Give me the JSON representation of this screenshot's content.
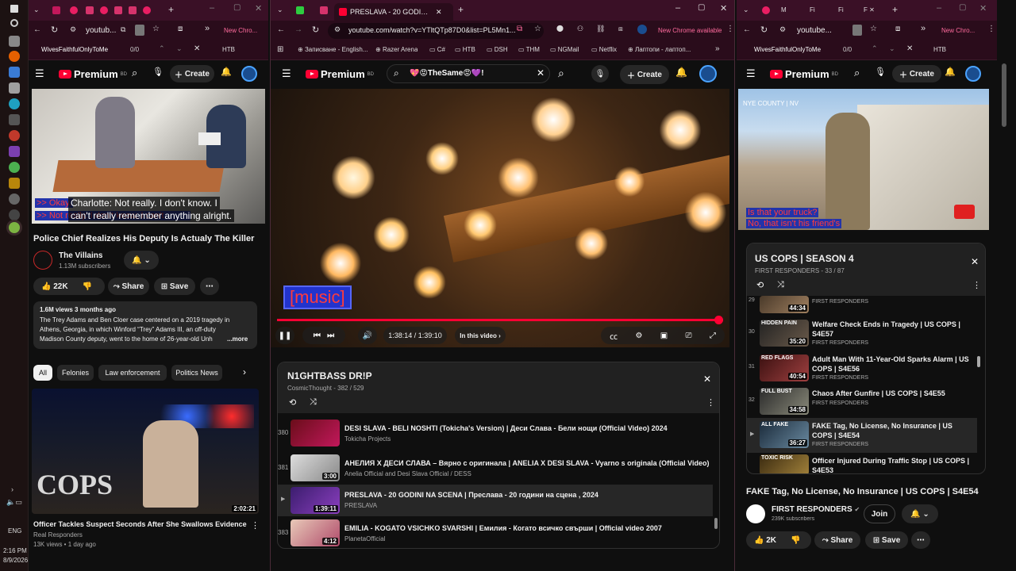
{
  "taskbar": {
    "time": "2:16 PM",
    "date": "8/9/2026",
    "lang": "ENG"
  },
  "left": {
    "tab_text": "youtub...",
    "find_text": "WivesFaithfulOnlyToMe",
    "find_count": "0/0",
    "bookmark": "HTB",
    "yt": {
      "logo": "Premium",
      "badge": "BD",
      "create": "Create"
    },
    "captions": [
      "Charlotte: Not really. I don't know. I",
      "can't really remember anything alright."
    ],
    "caption_overlay": [
      ">> Okay.",
      ">> Not really. I don't know. I can't"
    ],
    "title": "Police Chief Realizes His Deputy Is Actualy The Killer",
    "channel": "The Villains",
    "subs": "1.13M subscribers",
    "likes": "22K",
    "share": "Share",
    "save": "Save",
    "meta": "1.6M views  3 months ago",
    "desc1": "The Trey Adams and Ben Cloer case centered on a 2019 tragedy in",
    "desc2": "Athens, Georgia, in which Winford “Trey” Adams III, an off-duty",
    "desc3": "Madison County deputy, went to the home of 26-year-old Unh",
    "more": "...more",
    "chips": [
      "All",
      "Felonies",
      "Law enforcement",
      "Politics News"
    ],
    "rec_title": "Officer Tackles Suspect Seconds After She Swallows Evidence",
    "rec_channel": "Real Responders",
    "rec_meta": "13K views • 1 day ago",
    "rec_dur": "2:02:21",
    "cops": "COPS"
  },
  "mid": {
    "tab_title": "PRESLAVA - 20 GODINI NA",
    "chrome_avail": "New Chrome available",
    "url": "youtube.com/watch?v=YTltQTp87D0&list=PL5Mn1...",
    "bookmarks": [
      "Записване - English...",
      "Razer Arena",
      "C#",
      "HTB",
      "DSH",
      "THM",
      "NGMail",
      "Netflix",
      "Лаптопи - лаптоп..."
    ],
    "yt": {
      "logo": "Premium",
      "badge": "BD",
      "create": "Create",
      "search": "💖😡TheSame😡💜!"
    },
    "caption": "[music]",
    "time": "1:38:14 / 1:39:10",
    "in_video": "In this video",
    "progress": 0.99,
    "playlist": {
      "title": "N1GHTBASS DR!P",
      "sub": "CosmicThought - 382 / 529"
    },
    "rows": [
      {
        "idx": "380",
        "title": "DESI SLAVA - BELI NOSHTI (Tokicha's Version) | Деси Слава - Бели нощи (Official Video) 2024",
        "ch": "Tokicha Projects",
        "dur": ""
      },
      {
        "idx": "381",
        "title": "АНЕЛИЯ Х ДЕСИ СЛАВА – Вярно с оригинала | ANELIA X DESI SLAVA - Vyarno s originala (Official Video)",
        "ch": "Anelia Official and Desi Slava Official / DESS",
        "dur": "3:00"
      },
      {
        "idx": "▶",
        "title": "PRESLAVA - 20 GODINI NA SCENA | Преслава - 20 години на сцена , 2024",
        "ch": "PRESLAVA",
        "dur": "1:39:11"
      },
      {
        "idx": "383",
        "title": "EMILIA - KOGATO VSICHKO SVARSHI | Емилия - Когато всичко свърши | Official video 2007",
        "ch": "PlanetaOfficial",
        "dur": "4:12"
      }
    ]
  },
  "right": {
    "tab_text": "youtube...",
    "chrome_avail": "New Chro...",
    "find_text": "WivesFaithfulOnlyToMe",
    "find_count": "0/0",
    "bookmark": "HTB",
    "yt": {
      "logo": "Premium",
      "badge": "BD",
      "create": "Create"
    },
    "video_tag": "NYE COUNTY | NV",
    "cap1": "Is that your truck?",
    "cap2": "No, that isn't his friend's",
    "playlist": {
      "title": "US COPS | SEASON 4",
      "sub": "FIRST RESPONDERS - 33 / 87"
    },
    "rows": [
      {
        "idx": "29",
        "title": "",
        "ch": "FIRST RESPONDERS",
        "dur": "44:34",
        "tag": ""
      },
      {
        "idx": "30",
        "title": "Welfare Check Ends in Tragedy | US COPS | S4E57",
        "ch": "FIRST RESPONDERS",
        "dur": "35:20",
        "tag": "HIDDEN PAIN"
      },
      {
        "idx": "31",
        "title": "Adult Man With 11-Year-Old Sparks Alarm | US COPS | S4E56",
        "ch": "FIRST RESPONDERS",
        "dur": "40:54",
        "tag": "RED FLAGS"
      },
      {
        "idx": "32",
        "title": "Chaos After Gunfire | US COPS | S4E55",
        "ch": "FIRST RESPONDERS",
        "dur": "34:58",
        "tag": "FULL BUST"
      },
      {
        "idx": "▶",
        "title": "FAKE Tag, No License, No Insurance | US COPS | S4E54",
        "ch": "FIRST RESPONDERS",
        "dur": "36:27",
        "tag": "ALL FAKE"
      },
      {
        "idx": "34",
        "title": "Officer Injured During Traffic Stop | US COPS | S4E53",
        "ch": "",
        "dur": "",
        "tag": "TOXIC RISK"
      }
    ],
    "title": "FAKE Tag, No License, No Insurance | US COPS | S4E54",
    "channel": "FIRST RESPONDERS",
    "subs": "239K subscribers",
    "join": "Join",
    "likes": "2K",
    "share": "Share",
    "save": "Save"
  }
}
